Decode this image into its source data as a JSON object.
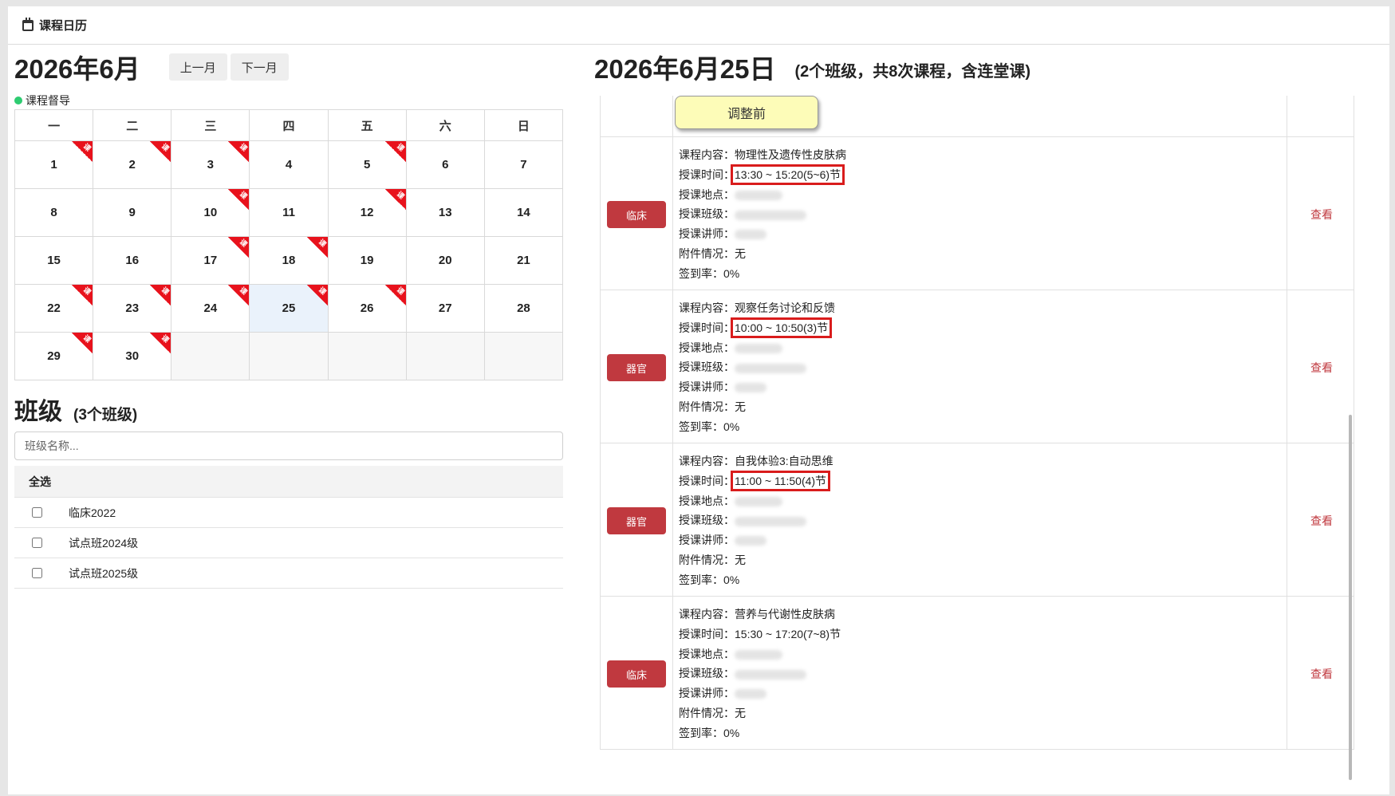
{
  "header": {
    "title": "课程日历",
    "icon": "calendar-icon"
  },
  "calendar": {
    "title": "2026年6月",
    "prev_label": "上一月",
    "next_label": "下一月",
    "legend": "课程督导",
    "legend_color": "#2ecc71",
    "ribbon_text": "课",
    "weekdays": [
      "一",
      "二",
      "三",
      "四",
      "五",
      "六",
      "日"
    ],
    "weeks": [
      [
        {
          "day": "1",
          "mark": true
        },
        {
          "day": "2",
          "mark": true
        },
        {
          "day": "3",
          "mark": true
        },
        {
          "day": "4",
          "mark": false
        },
        {
          "day": "5",
          "mark": true
        },
        {
          "day": "6",
          "mark": false
        },
        {
          "day": "7",
          "mark": false
        }
      ],
      [
        {
          "day": "8",
          "mark": false
        },
        {
          "day": "9",
          "mark": false
        },
        {
          "day": "10",
          "mark": true
        },
        {
          "day": "11",
          "mark": false
        },
        {
          "day": "12",
          "mark": true
        },
        {
          "day": "13",
          "mark": false
        },
        {
          "day": "14",
          "mark": false
        }
      ],
      [
        {
          "day": "15",
          "mark": false
        },
        {
          "day": "16",
          "mark": false
        },
        {
          "day": "17",
          "mark": true
        },
        {
          "day": "18",
          "mark": true
        },
        {
          "day": "19",
          "mark": false
        },
        {
          "day": "20",
          "mark": false
        },
        {
          "day": "21",
          "mark": false
        }
      ],
      [
        {
          "day": "22",
          "mark": true
        },
        {
          "day": "23",
          "mark": true
        },
        {
          "day": "24",
          "mark": true
        },
        {
          "day": "25",
          "mark": true,
          "today": true
        },
        {
          "day": "26",
          "mark": true
        },
        {
          "day": "27",
          "mark": false
        },
        {
          "day": "28",
          "mark": false
        }
      ],
      [
        {
          "day": "29",
          "mark": true
        },
        {
          "day": "30",
          "mark": true
        },
        {
          "day": ""
        },
        {
          "day": ""
        },
        {
          "day": ""
        },
        {
          "day": ""
        },
        {
          "day": ""
        }
      ]
    ]
  },
  "classes": {
    "title": "班级",
    "count": "(3个班级)",
    "search_placeholder": "班级名称...",
    "select_all": "全选",
    "items": [
      "临床2022",
      "试点班2024级",
      "试点班2025级"
    ]
  },
  "schedule": {
    "title": "2026年6月25日",
    "summary": "(2个班级，共8次课程，含连堂课)",
    "adjust_label": "调整前",
    "labels": {
      "content": "课程内容：",
      "time": "授课时间：",
      "place": "授课地点：",
      "class": "授课班级：",
      "teacher": "授课讲师：",
      "attach": "附件情况：",
      "rate": "签到率："
    },
    "view_label": "查看",
    "courses": [
      {
        "tag": "临床",
        "content": "物理性及遗传性皮肤病",
        "time": "13:30 ~ 15:20(5~6)节",
        "highlight": true,
        "attach": "无",
        "rate": "0%"
      },
      {
        "tag": "器官",
        "content": "观察任务讨论和反馈",
        "time": "10:00 ~ 10:50(3)节",
        "highlight": true,
        "attach": "无",
        "rate": "0%"
      },
      {
        "tag": "器官",
        "content": "自我体验3:自动思维",
        "time": "11:00 ~ 11:50(4)节",
        "highlight": true,
        "attach": "无",
        "rate": "0%"
      },
      {
        "tag": "临床",
        "content": "营养与代谢性皮肤病",
        "time": "15:30 ~ 17:20(7~8)节",
        "highlight": false,
        "attach": "无",
        "rate": "0%"
      }
    ]
  }
}
